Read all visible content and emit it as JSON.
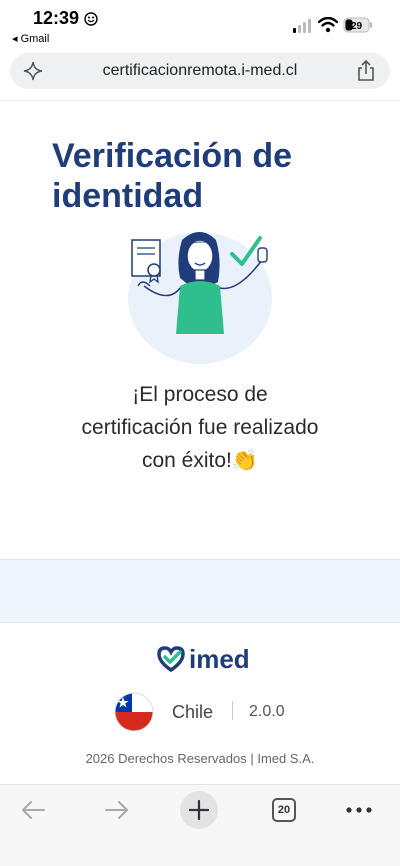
{
  "status": {
    "time": "12:39",
    "back_app": "◂ Gmail",
    "battery": "29"
  },
  "browser": {
    "url": "certificacionremota.i-med.cl",
    "tab_count": "20"
  },
  "main": {
    "title_line1": "Verificación de",
    "title_line2": "identidad",
    "message_line1": "¡El proceso de",
    "message_line2": "certificación fue realizado",
    "message_line3": "con éxito!👏"
  },
  "footer": {
    "brand": "imed",
    "country": "Chile",
    "version": "2.0.0",
    "rights": "2026 Derechos Reservados | Imed S.A."
  },
  "colors": {
    "brand_blue": "#1f3d7a",
    "accent_teal": "#2fbf8f",
    "band": "#eef5fc"
  }
}
